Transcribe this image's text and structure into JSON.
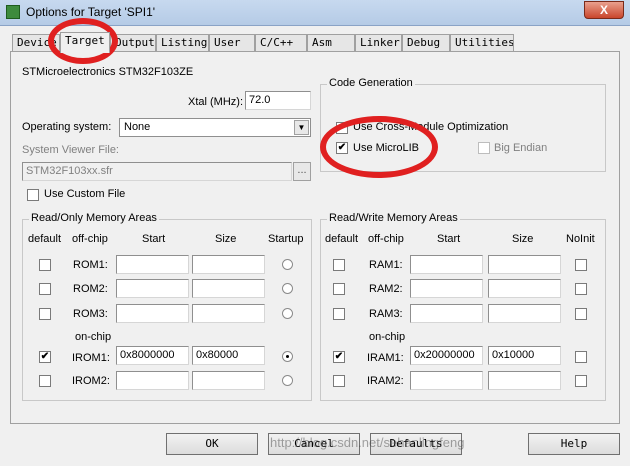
{
  "window": {
    "title": "Options for Target 'SPI1'",
    "close_glyph": "X"
  },
  "tabs": [
    {
      "label": "Device"
    },
    {
      "label": "Target",
      "active": true
    },
    {
      "label": "Output"
    },
    {
      "label": "Listing"
    },
    {
      "label": "User"
    },
    {
      "label": "C/C++"
    },
    {
      "label": "Asm"
    },
    {
      "label": "Linker"
    },
    {
      "label": "Debug"
    },
    {
      "label": "Utilities"
    }
  ],
  "device": {
    "name": "STMicroelectronics STM32F103ZE",
    "xtal_label": "Xtal (MHz):",
    "xtal_value": "72.0",
    "os_label": "Operating system:",
    "os_value": "None",
    "svf_label": "System Viewer File:",
    "svf_value": "STM32F103xx.sfr",
    "browse_label": "...",
    "custom_file_label": "Use Custom File"
  },
  "code_gen": {
    "title": "Code Generation",
    "cross_module_label": "Use Cross-Module Optimization",
    "microlib_label": "Use MicroLIB",
    "big_endian_label": "Big Endian",
    "checked_glyph": "✔"
  },
  "ro_memory": {
    "title": "Read/Only Memory Areas",
    "headers": {
      "default": "default",
      "offchip": "off-chip",
      "start": "Start",
      "size": "Size",
      "last": "Startup"
    },
    "onchip_label": "on-chip",
    "rows": [
      {
        "label": "ROM1:",
        "start": "",
        "size": "",
        "checked": false,
        "selected": false
      },
      {
        "label": "ROM2:",
        "start": "",
        "size": "",
        "checked": false,
        "selected": false
      },
      {
        "label": "ROM3:",
        "start": "",
        "size": "",
        "checked": false,
        "selected": false
      },
      {
        "label": "IROM1:",
        "start": "0x8000000",
        "size": "0x80000",
        "checked": true,
        "selected": true
      },
      {
        "label": "IROM2:",
        "start": "",
        "size": "",
        "checked": false,
        "selected": false
      }
    ]
  },
  "rw_memory": {
    "title": "Read/Write Memory Areas",
    "headers": {
      "default": "default",
      "offchip": "off-chip",
      "start": "Start",
      "size": "Size",
      "last": "NoInit"
    },
    "onchip_label": "on-chip",
    "rows": [
      {
        "label": "RAM1:",
        "start": "",
        "size": "",
        "checked": false,
        "noinit": false
      },
      {
        "label": "RAM2:",
        "start": "",
        "size": "",
        "checked": false,
        "noinit": false
      },
      {
        "label": "RAM3:",
        "start": "",
        "size": "",
        "checked": false,
        "noinit": false
      },
      {
        "label": "IRAM1:",
        "start": "0x20000000",
        "size": "0x10000",
        "checked": true,
        "noinit": false
      },
      {
        "label": "IRAM2:",
        "start": "",
        "size": "",
        "checked": false,
        "noinit": false
      }
    ]
  },
  "buttons": {
    "ok": "OK",
    "cancel": "Cancel",
    "defaults": "Defaults",
    "help": "Help"
  },
  "watermark": "http://blog.csdn.net/sehanlingfeng",
  "annotation_color": "#e02020"
}
